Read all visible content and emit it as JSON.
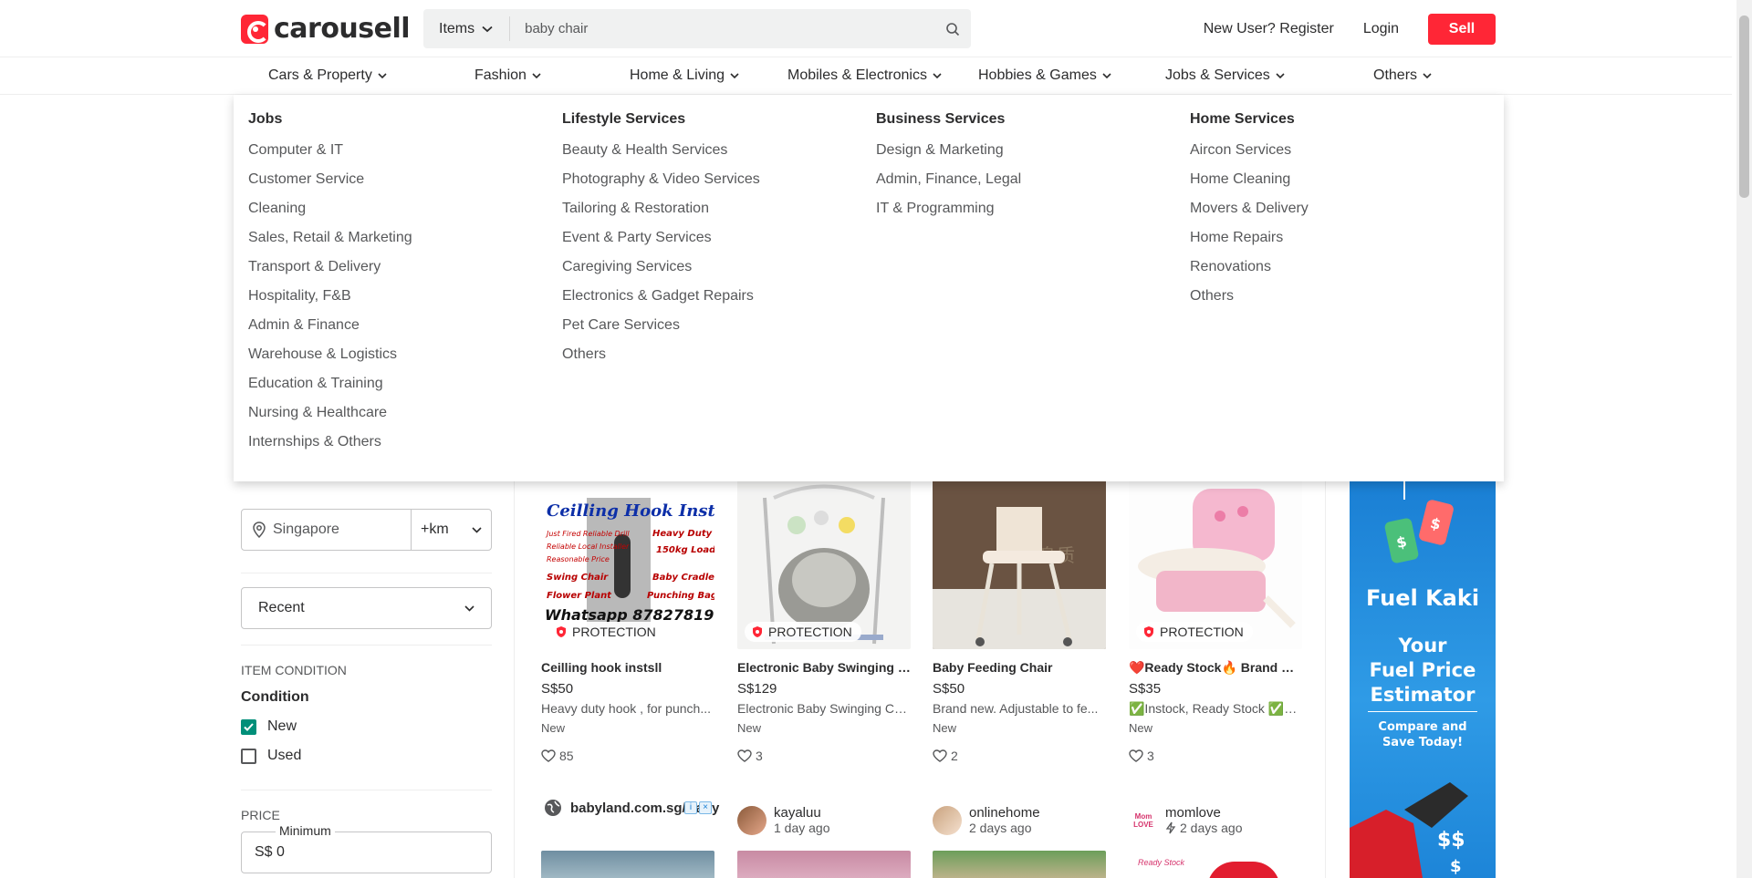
{
  "header": {
    "logo_text": "carousell",
    "search_category": "Items",
    "search_value": "baby chair",
    "register": "New User? Register",
    "login": "Login",
    "sell": "Sell"
  },
  "nav": {
    "categories": [
      "Cars & Property",
      "Fashion",
      "Home & Living",
      "Mobiles & Electronics",
      "Hobbies & Games",
      "Jobs & Services",
      "Others"
    ]
  },
  "mega_menu": {
    "columns": [
      {
        "title": "Jobs",
        "items": [
          "Computer & IT",
          "Customer Service",
          "Cleaning",
          "Sales, Retail & Marketing",
          "Transport & Delivery",
          "Hospitality, F&B",
          "Admin & Finance",
          "Warehouse & Logistics",
          "Education & Training",
          "Nursing & Healthcare",
          "Internships & Others"
        ]
      },
      {
        "title": "Lifestyle Services",
        "items": [
          "Beauty & Health Services",
          "Photography & Video Services",
          "Tailoring & Restoration",
          "Event & Party Services",
          "Caregiving Services",
          "Electronics & Gadget Repairs",
          "Pet Care Services",
          "Others"
        ]
      },
      {
        "title": "Business Services",
        "items": [
          "Design & Marketing",
          "Admin, Finance, Legal",
          "IT & Programming"
        ]
      },
      {
        "title": "Home Services",
        "items": [
          "Aircon Services",
          "Home Cleaning",
          "Movers & Delivery",
          "Home Repairs",
          "Renovations",
          "Others"
        ]
      }
    ]
  },
  "filters": {
    "location": "Singapore",
    "distance": "+km",
    "sort": "Recent",
    "item_condition_label": "ITEM CONDITION",
    "condition_title": "Condition",
    "conditions": [
      {
        "label": "New",
        "checked": true
      },
      {
        "label": "Used",
        "checked": false
      }
    ],
    "price_label": "PRICE",
    "price_min_legend": "Minimum",
    "price_min_value": "S$ 0"
  },
  "listings": [
    {
      "title": "Ceilling hook instsll",
      "price": "S$50",
      "desc": "Heavy duty hook , for punch...",
      "condition": "New",
      "likes": "85",
      "protection": "PROTECTION",
      "img_text": {
        "line1": "Ceilling Hook Install",
        "l2a": "Just Fired Reliable Drill",
        "l2b": "Heavy Duty",
        "l3a": "Reliable Local Installer",
        "l3b": "150kg Load",
        "l4": "Reasonable Price",
        "l5a": "Swing Chair",
        "l5b": "Baby Cradle",
        "l6a": "Flower Plant",
        "l6b": "Punching Bag",
        "l7": "Whatsapp 87827819"
      }
    },
    {
      "title": "Electronic Baby Swinging c...",
      "price": "S$129",
      "desc": "Electronic Baby Swinging Ch...",
      "condition": "New",
      "likes": "3",
      "protection": "PROTECTION"
    },
    {
      "title": "Baby Feeding Chair",
      "price": "S$50",
      "desc": "Brand new. Adjustable to fe...",
      "condition": "New",
      "likes": "2",
      "protection": "",
      "img_watermark": "终身质"
    },
    {
      "title": "❤️Ready Stock🔥 Brand Ne...",
      "price": "S$35",
      "desc": "✅Instock, Ready Stock ✅B...",
      "condition": "New",
      "likes": "3",
      "protection": "PROTECTION"
    }
  ],
  "sellers": [
    {
      "name": "babyland.com.sg/Baby",
      "time": ""
    },
    {
      "name": "kayaluu",
      "time": "1 day ago"
    },
    {
      "name": "onlinehome",
      "time": "2 days ago"
    },
    {
      "name": "momlove",
      "time": "2 days ago",
      "logo_text": "Mom LOVE",
      "thumb_text": "Ready Stock"
    }
  ],
  "banner": {
    "title": "Fuel Kaki",
    "line1": "Your",
    "line2": "Fuel Price",
    "line3": "Estimator",
    "sub1": "Compare and",
    "sub2": "Save Today!"
  },
  "colors": {
    "brand_red": "#ff2636",
    "check_green": "#008f79",
    "banner_blue": "#1a7fd4"
  }
}
